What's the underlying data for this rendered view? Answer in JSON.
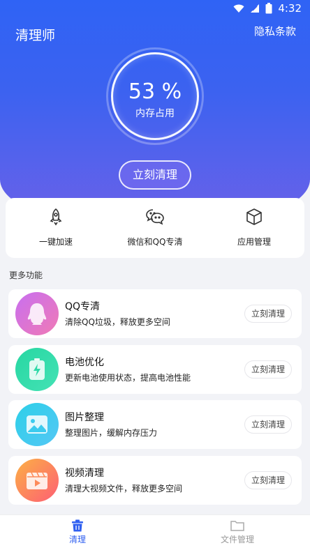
{
  "status": {
    "time": "4:32"
  },
  "header": {
    "title": "清理师",
    "privacy": "隐私条款"
  },
  "memory": {
    "percent_text": "53 %",
    "caption": "内存占用"
  },
  "hero": {
    "clean_button": "立刻清理"
  },
  "quick_actions": [
    {
      "label": "一键加速",
      "icon": "rocket-icon"
    },
    {
      "label": "微信和QQ专清",
      "icon": "chat-icon"
    },
    {
      "label": "应用管理",
      "icon": "box-icon"
    }
  ],
  "more": {
    "title": "更多功能"
  },
  "features": [
    {
      "title": "QQ专清",
      "desc": "清除QQ垃圾，释放更多空间",
      "button": "立刻清理",
      "icon": "penguin-icon",
      "color_from": "#c86ff0",
      "color_to": "#f07ab5"
    },
    {
      "title": "电池优化",
      "desc": "更新电池使用状态，提高电池性能",
      "button": "立刻清理",
      "icon": "battery-icon",
      "color_from": "#27d7a2",
      "color_to": "#44e2b5"
    },
    {
      "title": "图片整理",
      "desc": "整理图片，缓解内存压力",
      "button": "立刻清理",
      "icon": "image-icon",
      "color_from": "#2dd0e8",
      "color_to": "#54c7f5"
    },
    {
      "title": "视频清理",
      "desc": "清理大视频文件，释放更多空间",
      "button": "立刻清理",
      "icon": "video-icon",
      "color_from": "#fcb045",
      "color_to": "#fd5f74"
    }
  ],
  "nav": {
    "clean": "清理",
    "files": "文件管理"
  },
  "colors": {
    "accent": "#2f5ff0"
  }
}
